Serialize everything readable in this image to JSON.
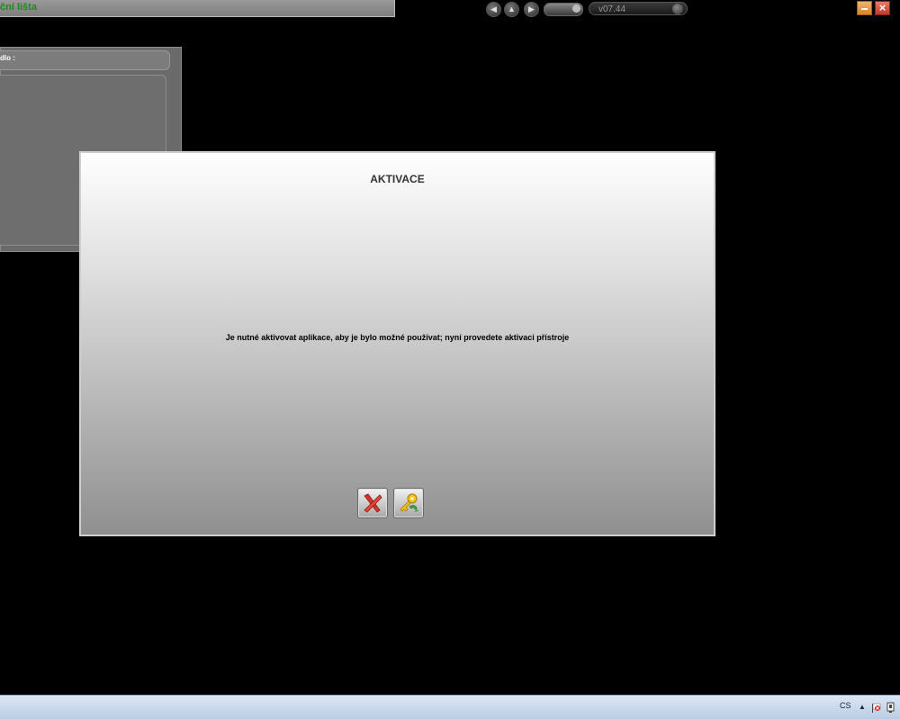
{
  "window": {
    "title": "ční lišta",
    "version": "v07.44"
  },
  "toolbar": {
    "icons": [
      "left-arrow-icon",
      "home-icon",
      "right-arrow-icon",
      "volume-slider",
      "version-display"
    ]
  },
  "background_panel": {
    "field_label": "dlo :"
  },
  "dialog": {
    "title": "AKTIVACE",
    "message": "Je nutné aktivovat aplikace, aby je bylo možné používat; nyní provedete aktivaci přístroje",
    "buttons": [
      {
        "name": "cancel",
        "icon": "red-x-icon"
      },
      {
        "name": "activate",
        "icon": "key-icon"
      }
    ]
  },
  "taskbar": {
    "language": "CS"
  },
  "colors": {
    "title_green": "#1a8a1a",
    "min_orange": "#e39545",
    "close_red": "#d04a3a"
  }
}
